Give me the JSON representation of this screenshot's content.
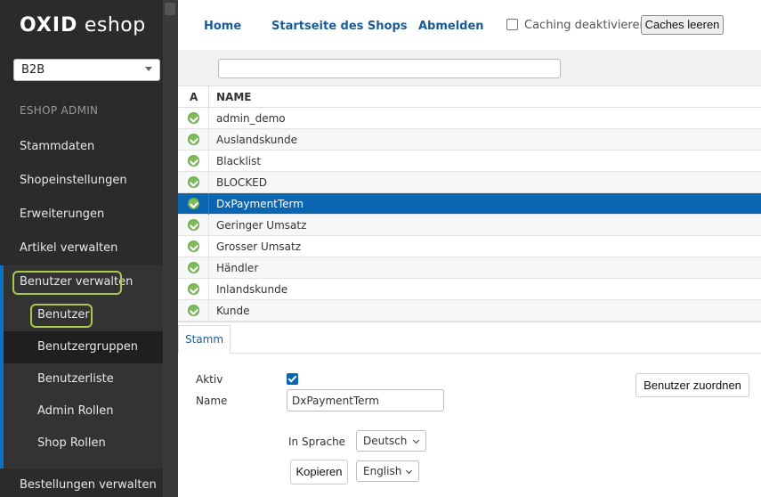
{
  "sidebar": {
    "logo_bold": "OXID",
    "logo_rest": " eshop",
    "shop_select": "B2B",
    "section_label": "ESHOP ADMIN",
    "items": [
      {
        "label": "Stammdaten"
      },
      {
        "label": "Shopeinstellungen"
      },
      {
        "label": "Erweiterungen"
      },
      {
        "label": "Artikel verwalten"
      },
      {
        "label": "Benutzer verwalten"
      }
    ],
    "subitems": [
      {
        "label": "Benutzer"
      },
      {
        "label": "Benutzergruppen"
      },
      {
        "label": "Benutzerliste"
      },
      {
        "label": "Admin Rollen"
      },
      {
        "label": "Shop Rollen"
      }
    ],
    "bottom_item": "Bestellungen verwalten"
  },
  "topnav": {
    "home": "Home",
    "shop_start": "Startseite des Shops",
    "logout": "Abmelden",
    "caching_label": "Caching deaktivieren",
    "clear_caches": "Caches leeren"
  },
  "list": {
    "col_active": "A",
    "col_name": "NAME",
    "rows": [
      {
        "name": "admin_demo"
      },
      {
        "name": "Auslandskunde"
      },
      {
        "name": "Blacklist"
      },
      {
        "name": "BLOCKED"
      },
      {
        "name": "DxPaymentTerm"
      },
      {
        "name": "Geringer Umsatz"
      },
      {
        "name": "Grosser Umsatz"
      },
      {
        "name": "Händler"
      },
      {
        "name": "Inlandskunde"
      },
      {
        "name": "Kunde"
      }
    ],
    "selected": "DxPaymentTerm"
  },
  "detail": {
    "tab": "Stamm",
    "active_label": "Aktiv",
    "name_label": "Name",
    "name_value": "DxPaymentTerm",
    "assign_button": "Benutzer zuordnen",
    "language_label": "In Sprache",
    "language_value": "Deutsch",
    "copy_button": "Kopieren",
    "copy_language": "English"
  },
  "colors": {
    "accent": "#0b66b2",
    "highlight": "#a8c94a",
    "sidebar_bg": "#2b2b2b"
  }
}
